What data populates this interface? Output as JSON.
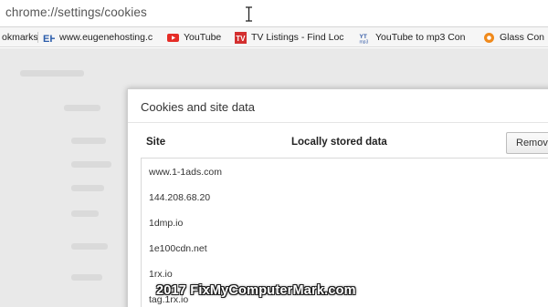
{
  "omnibox": {
    "url": "chrome://settings/cookies"
  },
  "bookmarks_bar": {
    "items": [
      {
        "label": "okmarks",
        "icon": "bookmarks-folder-icon"
      },
      {
        "label": "www.eugenehosting.c",
        "icon": "eh-favicon",
        "icon_text": "EH"
      },
      {
        "label": "YouTube",
        "icon": "youtube-icon",
        "icon_color": "#e52d27"
      },
      {
        "label": "TV Listings - Find Loc",
        "icon": "tv-listings-icon",
        "icon_text": "TV",
        "icon_color": "#d32f2f"
      },
      {
        "label": "YouTube to mp3 Con",
        "icon": "youtube-mp3-icon",
        "icon_text": "YT"
      },
      {
        "label": "Glass Con",
        "icon": "glass-icon",
        "icon_color": "#f08a1c"
      }
    ]
  },
  "dialog": {
    "title": "Cookies and site data",
    "columns": {
      "site": "Site",
      "data": "Locally stored data"
    },
    "remove_label": "Remove all",
    "sites": [
      "www.1-1ads.com",
      "144.208.68.20",
      "1dmp.io",
      "1e100cdn.net",
      "1rx.io",
      "tag.1rx.io"
    ]
  },
  "watermark": "2017 FixMyComputerMark.com",
  "colors": {
    "youtube_red": "#e52d27",
    "glass_orange": "#f08a1c",
    "settings_bg": "#e9e9e9"
  }
}
